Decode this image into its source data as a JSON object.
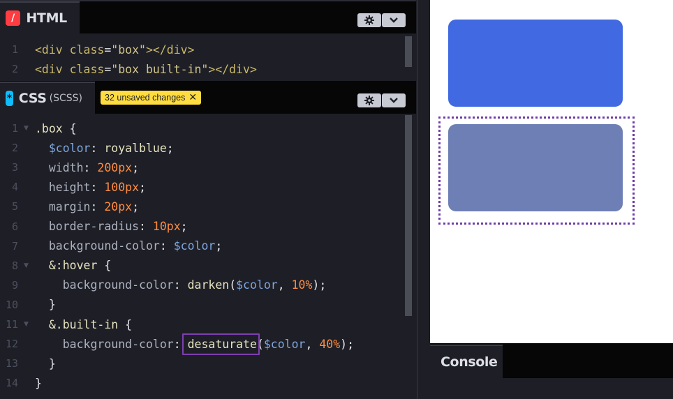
{
  "html_pane": {
    "title": "HTML",
    "icon": "html-slash-icon",
    "icon_glyph": "/",
    "icon_color": "#ff3c41",
    "settings_icon": "gear-icon",
    "collapse_icon": "chevron-down-icon",
    "lines": [
      {
        "n": "1",
        "segments": [
          {
            "t": "<div ",
            "c": "c-tag"
          },
          {
            "t": "class",
            "c": "c-tag"
          },
          {
            "t": "=",
            "c": "c-punct"
          },
          {
            "t": "\"box\"",
            "c": "c-str"
          },
          {
            "t": "></div>",
            "c": "c-tag"
          }
        ]
      },
      {
        "n": "2",
        "segments": [
          {
            "t": "<div ",
            "c": "c-tag"
          },
          {
            "t": "class",
            "c": "c-tag"
          },
          {
            "t": "=",
            "c": "c-punct"
          },
          {
            "t": "\"box built-in\"",
            "c": "c-str"
          },
          {
            "t": "></div>",
            "c": "c-tag"
          }
        ]
      }
    ]
  },
  "css_pane": {
    "title": "CSS",
    "subtitle": "(SCSS)",
    "icon": "css-asterisk-icon",
    "icon_glyph": "*",
    "icon_color": "#0ebeff",
    "badge": {
      "text": "32 unsaved changes",
      "close_glyph": "✕"
    },
    "settings_icon": "gear-icon",
    "collapse_icon": "chevron-down-icon",
    "lines": [
      {
        "n": "1",
        "fold": true,
        "indent": 0,
        "segments": [
          {
            "t": ".box ",
            "c": "c-sel"
          },
          {
            "t": "{",
            "c": "c-punct"
          }
        ]
      },
      {
        "n": "2",
        "fold": false,
        "indent": 1,
        "segments": [
          {
            "t": "$color",
            "c": "c-var"
          },
          {
            "t": ": ",
            "c": "c-punct"
          },
          {
            "t": "royalblue",
            "c": "c-fn"
          },
          {
            "t": ";",
            "c": "c-punct"
          }
        ]
      },
      {
        "n": "3",
        "fold": false,
        "indent": 1,
        "segments": [
          {
            "t": "width",
            "c": "c-prop"
          },
          {
            "t": ": ",
            "c": "c-punct"
          },
          {
            "t": "200px",
            "c": "c-num"
          },
          {
            "t": ";",
            "c": "c-punct"
          }
        ]
      },
      {
        "n": "4",
        "fold": false,
        "indent": 1,
        "segments": [
          {
            "t": "height",
            "c": "c-prop"
          },
          {
            "t": ": ",
            "c": "c-punct"
          },
          {
            "t": "100px",
            "c": "c-num"
          },
          {
            "t": ";",
            "c": "c-punct"
          }
        ]
      },
      {
        "n": "5",
        "fold": false,
        "indent": 1,
        "segments": [
          {
            "t": "margin",
            "c": "c-prop"
          },
          {
            "t": ": ",
            "c": "c-punct"
          },
          {
            "t": "20px",
            "c": "c-num"
          },
          {
            "t": ";",
            "c": "c-punct"
          }
        ]
      },
      {
        "n": "6",
        "fold": false,
        "indent": 1,
        "segments": [
          {
            "t": "border-radius",
            "c": "c-prop"
          },
          {
            "t": ": ",
            "c": "c-punct"
          },
          {
            "t": "10px",
            "c": "c-num"
          },
          {
            "t": ";",
            "c": "c-punct"
          }
        ]
      },
      {
        "n": "7",
        "fold": false,
        "indent": 1,
        "segments": [
          {
            "t": "background-color",
            "c": "c-prop"
          },
          {
            "t": ": ",
            "c": "c-punct"
          },
          {
            "t": "$color",
            "c": "c-var"
          },
          {
            "t": ";",
            "c": "c-punct"
          }
        ]
      },
      {
        "n": "8",
        "fold": true,
        "indent": 1,
        "segments": [
          {
            "t": "&:hover ",
            "c": "c-sel"
          },
          {
            "t": "{",
            "c": "c-punct"
          }
        ]
      },
      {
        "n": "9",
        "fold": false,
        "indent": 2,
        "segments": [
          {
            "t": "background-color",
            "c": "c-prop"
          },
          {
            "t": ": ",
            "c": "c-punct"
          },
          {
            "t": "darken",
            "c": "c-fn"
          },
          {
            "t": "(",
            "c": "c-punct"
          },
          {
            "t": "$color",
            "c": "c-var"
          },
          {
            "t": ", ",
            "c": "c-punct"
          },
          {
            "t": "10%",
            "c": "c-num"
          },
          {
            "t": ");",
            "c": "c-punct"
          }
        ]
      },
      {
        "n": "10",
        "fold": false,
        "indent": 1,
        "segments": [
          {
            "t": "}",
            "c": "c-punct"
          }
        ]
      },
      {
        "n": "11",
        "fold": true,
        "indent": 1,
        "segments": [
          {
            "t": "&.built-in ",
            "c": "c-sel"
          },
          {
            "t": "{",
            "c": "c-punct"
          }
        ]
      },
      {
        "n": "12",
        "fold": false,
        "indent": 2,
        "segments": [
          {
            "t": "background-color",
            "c": "c-prop"
          },
          {
            "t": ": ",
            "c": "c-punct"
          },
          {
            "t": "desaturate",
            "c": "c-fn",
            "highlight": true
          },
          {
            "t": "(",
            "c": "c-punct"
          },
          {
            "t": "$color",
            "c": "c-var"
          },
          {
            "t": ", ",
            "c": "c-punct"
          },
          {
            "t": "40%",
            "c": "c-num"
          },
          {
            "t": ");",
            "c": "c-punct"
          }
        ]
      },
      {
        "n": "13",
        "fold": false,
        "indent": 1,
        "segments": [
          {
            "t": "}",
            "c": "c-punct"
          }
        ]
      },
      {
        "n": "14",
        "fold": false,
        "indent": 0,
        "segments": [
          {
            "t": "}",
            "c": "c-punct"
          }
        ]
      }
    ]
  },
  "preview": {
    "box_color": "#4169e1",
    "built_in_box_color": "#6e7fb5",
    "outline_color": "#6d3bab"
  },
  "console": {
    "title": "Console"
  },
  "colors": {
    "editor_bg": "#1e1f26",
    "chrome_bg": "#060606",
    "highlight": "#7d3fb0"
  }
}
